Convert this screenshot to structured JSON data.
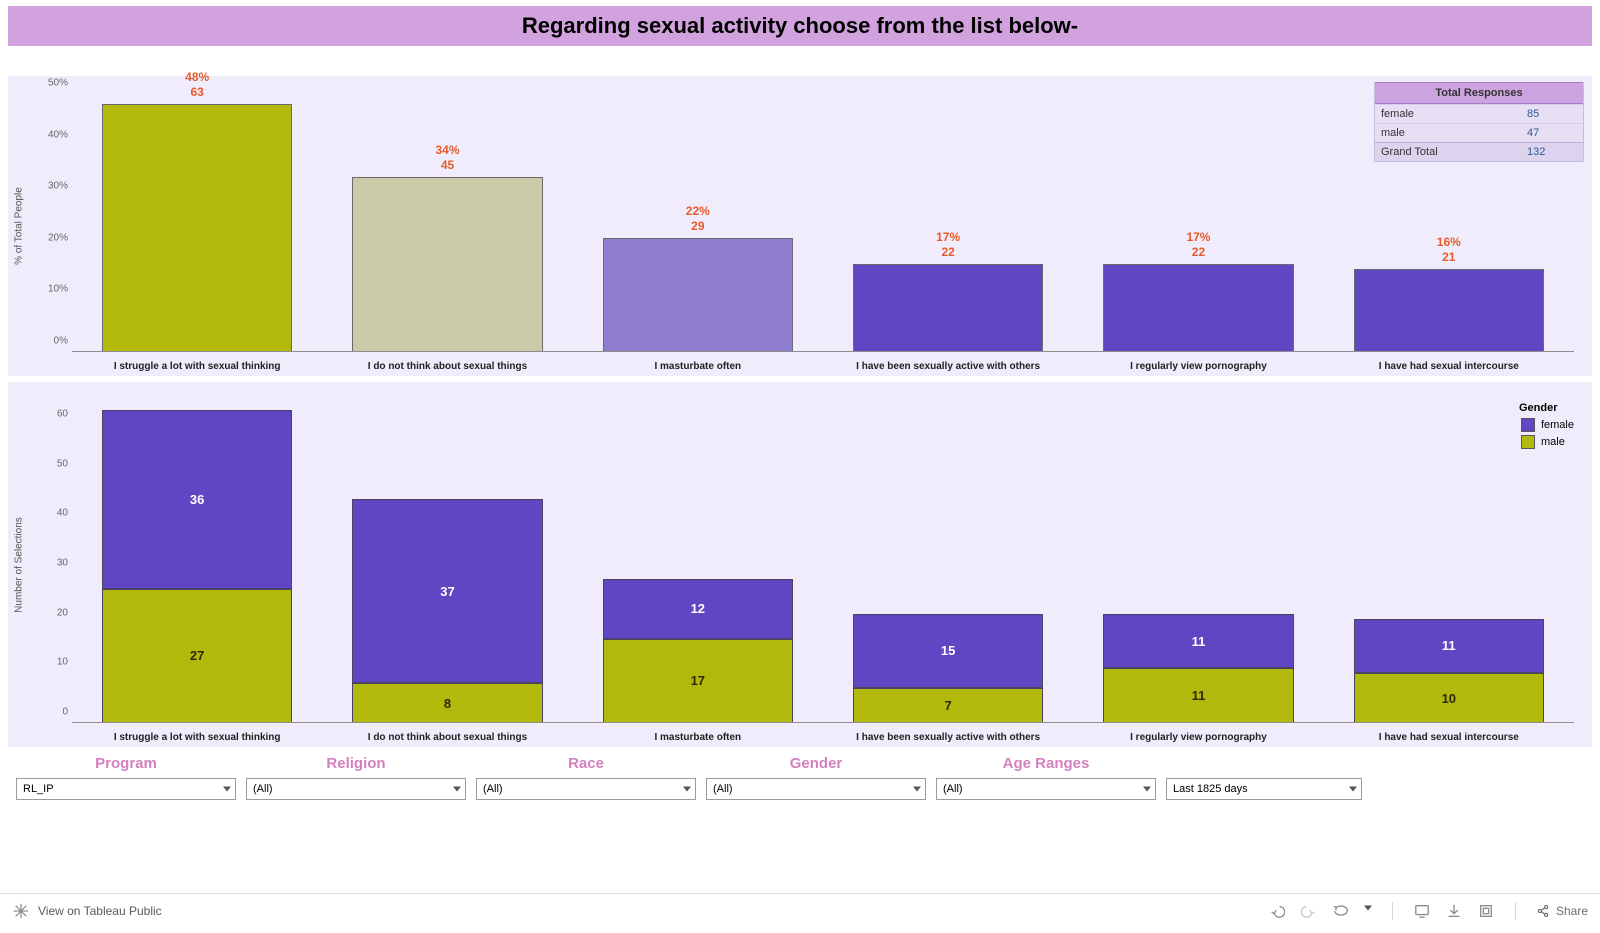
{
  "title": "Regarding sexual activity choose from the list below-",
  "totals_header": "Total Responses",
  "totals": {
    "female_label": "female",
    "female_count": 85,
    "male_label": "male",
    "male_count": 47,
    "grand_label": "Grand Total",
    "grand_count": 132
  },
  "legend": {
    "title": "Gender",
    "female": "female",
    "male": "male"
  },
  "filters": {
    "program_label": "Program",
    "program_value": "RL_IP",
    "religion_label": "Religion",
    "religion_value": "(All)",
    "race_label": "Race",
    "race_value": "(All)",
    "gender_label": "Gender",
    "gender_value": "(All)",
    "age_label": "Age Ranges",
    "age_value": "(All)",
    "date_value": "Last 1825 days"
  },
  "axis": {
    "top_label": "% of Total People",
    "bottom_label": "Number of Selections"
  },
  "footer": {
    "view_on": "View on Tableau Public",
    "share": "Share"
  },
  "chart_data": [
    {
      "type": "bar",
      "title": "% of Total People by response",
      "ylabel": "% of Total People",
      "ylim": [
        0,
        50
      ],
      "categories": [
        "I struggle a lot with sexual thinking",
        "I do not think about sexual things",
        "I masturbate often",
        "I have been sexually active with others",
        "I regularly view pornography",
        "I have had sexual intercourse"
      ],
      "values_pct": [
        48,
        34,
        22,
        17,
        17,
        16
      ],
      "values_count": [
        63,
        45,
        29,
        22,
        22,
        21
      ],
      "bar_colors": [
        "#b2b80c",
        "#c9caa8",
        "#8f7dd0",
        "#5f46c2",
        "#5f46c2",
        "#5f46c2"
      ]
    },
    {
      "type": "bar",
      "stacked": true,
      "title": "Number of Selections by Gender",
      "ylabel": "Number of Selections",
      "ylim": [
        0,
        65
      ],
      "categories": [
        "I struggle a lot with sexual thinking",
        "I do not think about sexual things",
        "I masturbate often",
        "I have been sexually active with others",
        "I regularly view pornography",
        "I have had sexual intercourse"
      ],
      "series": [
        {
          "name": "male",
          "color": "#b2b80c",
          "values": [
            27,
            8,
            17,
            7,
            11,
            10
          ]
        },
        {
          "name": "female",
          "color": "#5f46c2",
          "values": [
            36,
            37,
            12,
            15,
            11,
            11
          ]
        }
      ]
    }
  ]
}
